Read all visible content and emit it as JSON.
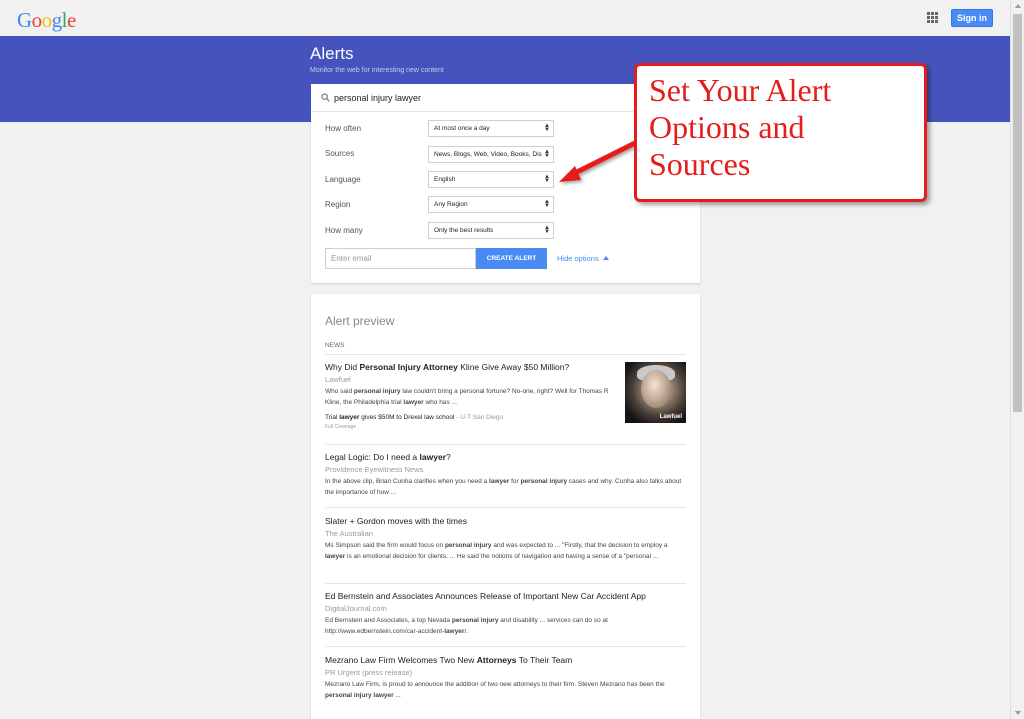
{
  "header": {
    "logo": [
      "G",
      "o",
      "o",
      "g",
      "l",
      "e"
    ],
    "apps_icon": "apps-grid-icon",
    "signin_label": "Sign in"
  },
  "banner": {
    "title": "Alerts",
    "subtitle": "Monitor the web for interesting new content"
  },
  "search": {
    "icon": "search-icon",
    "query": "personal injury lawyer"
  },
  "options": [
    {
      "label": "How often",
      "value": "At most once a day"
    },
    {
      "label": "Sources",
      "value": "News, Blogs, Web, Video, Books, Dis"
    },
    {
      "label": "Language",
      "value": "English"
    },
    {
      "label": "Region",
      "value": "Any Region"
    },
    {
      "label": "How many",
      "value": "Only the best results"
    }
  ],
  "email": {
    "placeholder": "Enter email"
  },
  "create_button": "CREATE ALERT",
  "hide_options": "Hide options",
  "preview": {
    "title": "Alert preview",
    "section": "NEWS",
    "articles": [
      {
        "title_parts": [
          "Why Did ",
          "Personal Injury Attorney",
          " Kline Give Away $50 Million?"
        ],
        "source": "Lawfuel",
        "snippet_parts": [
          "Who said ",
          "personal injury",
          " law couldn't bring a personal fortune? No-one, right? Well for Thomas R Kline, the Philadelphia trial ",
          "lawyer",
          " who has ..."
        ],
        "related_parts": [
          "Trial ",
          "lawyer",
          " gives $50M to Drexel law school"
        ],
        "related_source": " - U-T San Diego",
        "full_coverage": "Full Coverage",
        "thumb_caption": "Lawfuel"
      },
      {
        "title_parts": [
          "Legal Logic: Do I need a ",
          "lawyer",
          "?"
        ],
        "source": "Providence Eyewitness News",
        "snippet_parts": [
          "In the above clip, Brian Cunha clarifies when you need a ",
          "lawyer",
          " for ",
          "personal injury",
          " cases and why. Cunha also talks about the importance of how ..."
        ]
      },
      {
        "title_parts": [
          "Slater + Gordon moves with the times"
        ],
        "source": "The Australian",
        "snippet_parts": [
          "Ms Simpson said the firm would focus on ",
          "personal injury",
          " and was expected to ... \"Firstly, that the decision to employ a ",
          "lawyer",
          " is an emotional decision for clients. ... He said the notions of navigation and having a sense of a \"personal ..."
        ]
      },
      {
        "title_parts": [
          "Ed Bernstein and Associates Announces Release of Important New Car Accident App"
        ],
        "source": "DigitalJournal.com",
        "snippet_parts": [
          "Ed Bernstein and Associates, a top Nevada ",
          "personal injury",
          " and disability ... services can do so at http://www.edbernstein.com/car-accident-",
          "lawyer",
          "/."
        ]
      },
      {
        "title_parts": [
          "Mezrano Law Firm Welcomes Two New ",
          "Attorneys",
          " To Their Team"
        ],
        "source": "PR Urgent (press release)",
        "snippet_parts": [
          "Mezrano Law Firm, is proud to announce the addition of two new attorneys to their firm. Steven Mezrano has been the ",
          "personal injury lawyer",
          " ..."
        ]
      }
    ]
  },
  "callout": {
    "lines": [
      "Set Your Alert",
      "Options and",
      "Sources"
    ],
    "color": "#e51c1c"
  },
  "colors": {
    "banner": "#4653bd",
    "accent": "#4a8af4"
  }
}
